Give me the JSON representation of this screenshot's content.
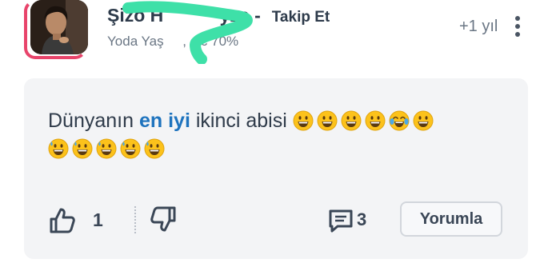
{
  "post": {
    "author": {
      "name_visible_start": "Şizo",
      "name_visible_mid": "H",
      "name_visible_end": "yze -",
      "subtitle_start": "Yoda Yaş",
      "subtitle_end": ", eic 70%"
    },
    "follow_label": "Takip Et",
    "time_label": "+1 yıl"
  },
  "comment": {
    "text_before": "Dünyanın ",
    "highlight": "en iyi",
    "text_after": " ikinci abisi ",
    "emoji_line1": [
      "grinning-face-emoji",
      "grinning-face-emoji",
      "grinning-face-emoji",
      "grinning-face-emoji",
      "face-with-tears-of-joy-emoji",
      "grinning-face-emoji"
    ],
    "emoji_line2": [
      "grinning-face-with-sweat-emoji",
      "grinning-face-with-sweat-emoji",
      "grinning-face-with-sweat-emoji",
      "grinning-face-with-sweat-emoji",
      "grinning-face-with-sweat-emoji"
    ]
  },
  "actions": {
    "like_icon": "thumbs-up-icon",
    "like_count": "1",
    "dislike_icon": "thumbs-down-icon",
    "reply_icon": "comment-icon",
    "reply_count": "3",
    "reply_button_label": "Yorumla",
    "more_icon": "vertical-dots-icon"
  },
  "colors": {
    "highlight": "#1e73be",
    "avatar_ring": "#e8446b",
    "redaction_marker": "#3ee0a8",
    "card_background": "#f3f4f6",
    "text": "#2f3b4a"
  }
}
